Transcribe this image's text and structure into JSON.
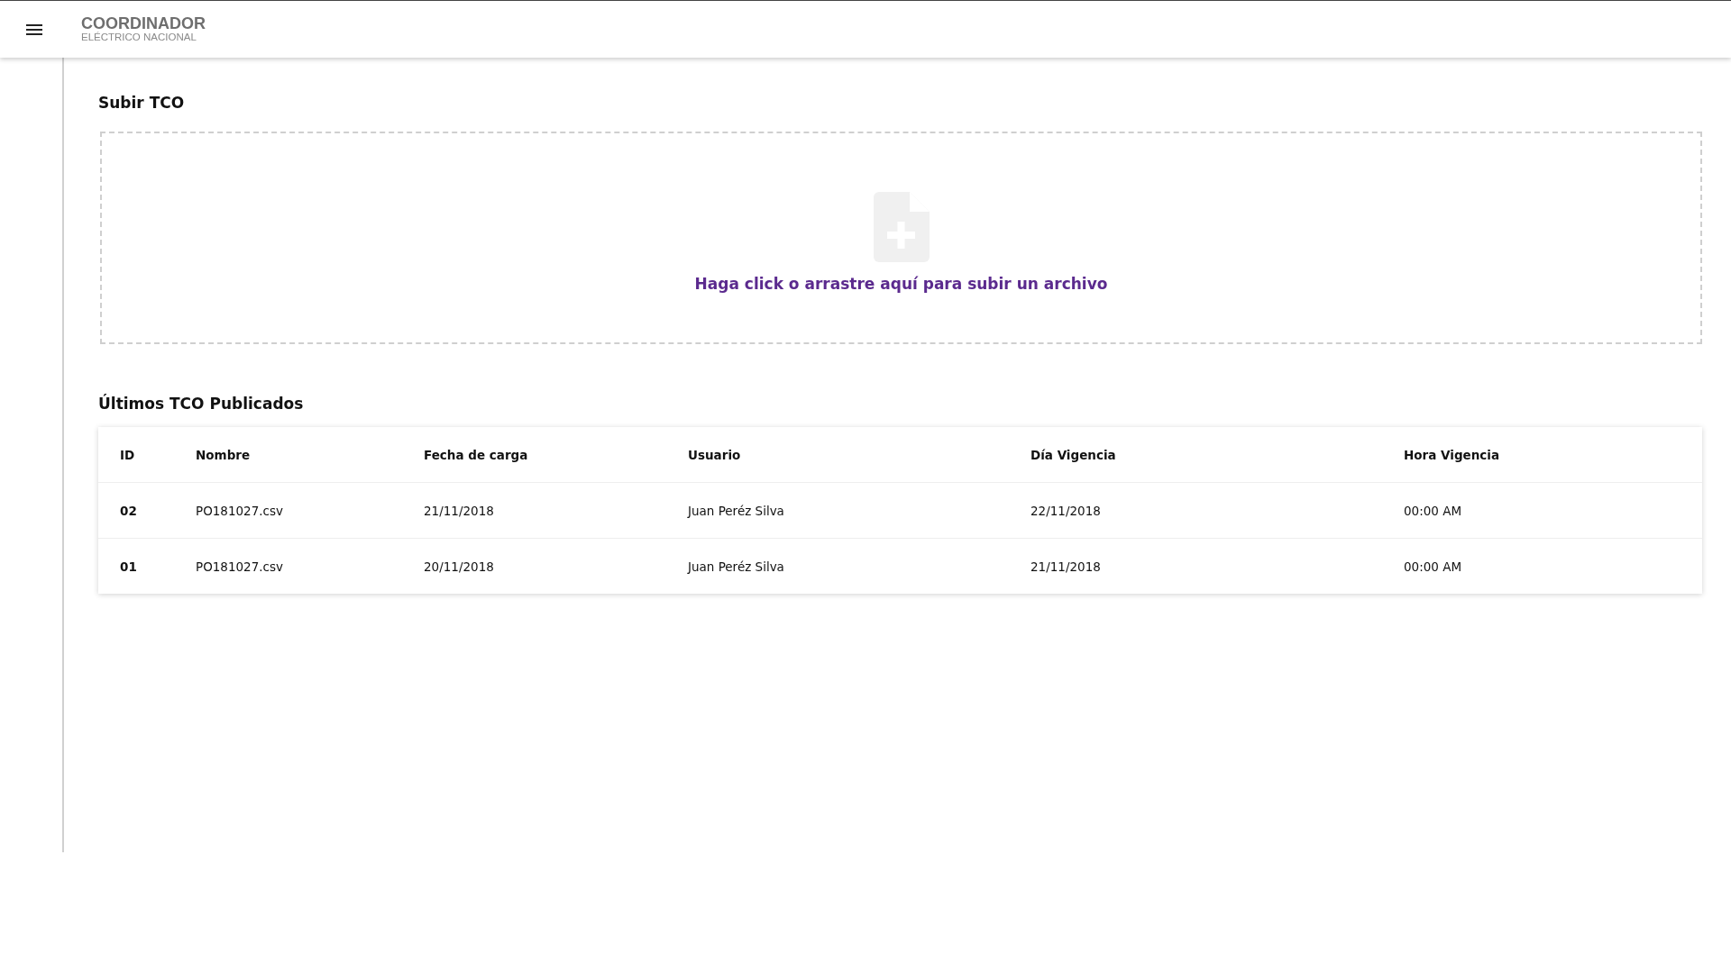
{
  "header": {
    "logo_title": "COORDINADOR",
    "logo_subtitle": "ELÉCTRICO NACIONAL"
  },
  "upload": {
    "title": "Subir TCO",
    "dropzone_text": "Haga click o arrastre aquí para subir un archivo"
  },
  "table": {
    "title": "Últimos TCO Publicados",
    "columns": [
      "ID",
      "Nombre",
      "Fecha de carga",
      "Usuario",
      "Día Vigencia",
      "Hora Vigencia"
    ],
    "rows": [
      [
        "02",
        "PO181027.csv",
        "21/11/2018",
        "Juan Peréz Silva",
        "22/11/2018",
        "00:00 AM"
      ],
      [
        "01",
        "PO181027.csv",
        "20/11/2018",
        "Juan Peréz Silva",
        "21/11/2018",
        "00:00 AM"
      ]
    ]
  }
}
